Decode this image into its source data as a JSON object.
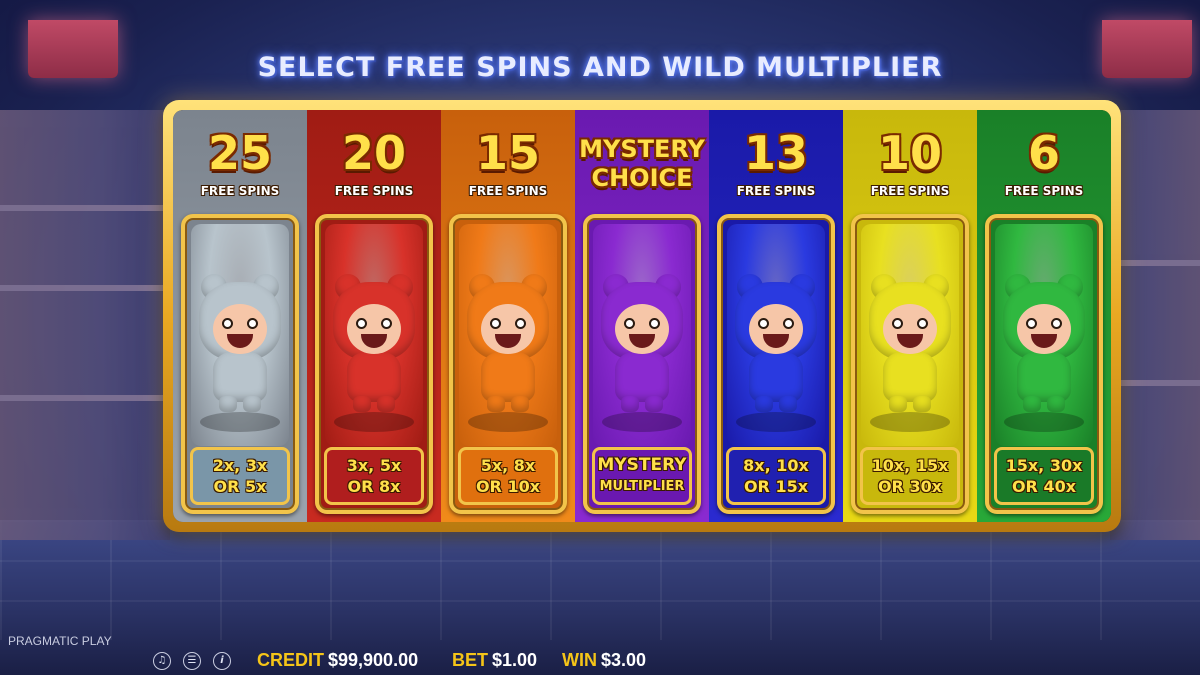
{
  "title": "SELECT FREE SPINS AND WILD MULTIPLIER",
  "options": [
    {
      "spins": "25",
      "spins_label": "FREE SPINS",
      "multiplier_line1": "2x, 3x",
      "multiplier_line2": "OR 5x",
      "character": "grey-bear-icon",
      "color": "#9aa3ad",
      "header_color": "#7c848e",
      "card_color": "#b8c4cc",
      "mult_color": "#7a96a8"
    },
    {
      "spins": "20",
      "spins_label": "FREE SPINS",
      "multiplier_line1": "3x, 5x",
      "multiplier_line2": "OR 8x",
      "character": "red-bear-icon",
      "color": "#c82a20",
      "header_color": "#a01c14",
      "card_color": "#d8322a",
      "mult_color": "#b01e1e"
    },
    {
      "spins": "15",
      "spins_label": "FREE SPINS",
      "multiplier_line1": "5x, 8x",
      "multiplier_line2": "OR 10x",
      "character": "orange-bear-icon",
      "color": "#f08a1a",
      "header_color": "#c8600c",
      "card_color": "#f07a18",
      "mult_color": "#e0700e"
    },
    {
      "spins_line1": "MYSTERY",
      "spins_line2": "CHOICE",
      "multiplier_line1": "MYSTERY",
      "multiplier_line2": "MULTIPLIER",
      "character": "purple-bear-icon",
      "color": "#8a2ad0",
      "header_color": "#6a1ab0",
      "card_color": "#8a2ad0",
      "mult_color": "#6a18b0"
    },
    {
      "spins": "13",
      "spins_label": "FREE SPINS",
      "multiplier_line1": "8x, 10x",
      "multiplier_line2": "OR 15x",
      "character": "blue-bear-icon",
      "color": "#2a2ad0",
      "header_color": "#1a1aa8",
      "card_color": "#2a3ae0",
      "mult_color": "#2020b0"
    },
    {
      "spins": "10",
      "spins_label": "FREE SPINS",
      "multiplier_line1": "10x, 15x",
      "multiplier_line2": "OR 30x",
      "character": "yellow-bear-icon",
      "color": "#e8d814",
      "header_color": "#c8b80c",
      "card_color": "#e8e020",
      "mult_color": "#c8b80c"
    },
    {
      "spins": "6",
      "spins_label": "FREE SPINS",
      "multiplier_line1": "15x, 30x",
      "multiplier_line2": "OR 40x",
      "character": "green-bear-icon",
      "color": "#28a838",
      "header_color": "#1a8028",
      "card_color": "#30b840",
      "mult_color": "#1a7a28"
    }
  ],
  "footer": {
    "brand": "PRAGMATIC PLAY",
    "credit_label": "CREDIT",
    "credit_value": "$99,900.00",
    "bet_label": "BET",
    "bet_value": "$1.00",
    "win_label": "WIN",
    "win_value": "$3.00",
    "controls": [
      "sound-icon",
      "menu-icon",
      "info-icon"
    ]
  }
}
